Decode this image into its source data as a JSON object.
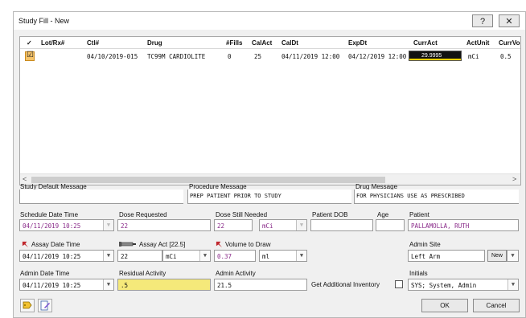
{
  "window": {
    "title": "Study Fill - New",
    "help": "?",
    "close": "✕"
  },
  "grid": {
    "columns": [
      "✓",
      "Lot/Rx#",
      "Ctl#",
      "Drug",
      "#Fills",
      "CalAct",
      "CalDt",
      "ExpDt",
      "CurrAct",
      "ActUnit",
      "CurrVol"
    ],
    "row": {
      "checked": "☑",
      "lot": "",
      "ctl": "04/10/2019-015",
      "drug": "TC99M CARDIOLITE",
      "fills": "0",
      "calact": "25",
      "caldt": "04/11/2019 12:00",
      "expdt": "04/12/2019 12:00",
      "curract": "29.9995",
      "actunit": "mCi",
      "currvol": "0.5"
    },
    "scroll_left": "<",
    "scroll_right": ">"
  },
  "messages": {
    "study_default_label": "Study Default Message",
    "study_default_value": "",
    "procedure_label": "Procedure Message",
    "procedure_value": "PREP PATIENT PRIOR TO STUDY",
    "drug_label": "Drug Message",
    "drug_value": "FOR PHYSICIANS USE AS PRESCRIBED"
  },
  "row1": {
    "schedule_label": "Schedule Date Time",
    "schedule_value": "04/11/2019 10:25",
    "dose_req_label": "Dose Requested",
    "dose_req_value": "22",
    "dose_still_label": "Dose Still Needed",
    "dose_still_value": "22",
    "dose_still_unit": "mCi",
    "dob_label": "Patient DOB",
    "dob_value": "",
    "age_label": "Age",
    "age_value": "",
    "patient_label": "Patient",
    "patient_value": "PALLAMOLLA, RUTH"
  },
  "row2": {
    "assay_dt_label": "Assay Date Time",
    "assay_dt_value": "04/11/2019 10:25",
    "assay_act_label": "Assay Act [22.5]",
    "assay_act_value": "22",
    "assay_act_unit": "mCi",
    "volume_label": "Volume to Draw",
    "volume_value": "0.37",
    "volume_unit": "ml",
    "site_label": "Admin Site",
    "site_value": "Left Arm",
    "site_new": "New"
  },
  "row3": {
    "admin_dt_label": "Admin Date Time",
    "admin_dt_value": "04/11/2019 10:25",
    "residual_label": "Residual Activity",
    "residual_value": ".5",
    "admin_act_label": "Admin Activity",
    "admin_act_value": "21.5",
    "inventory_label": "Get Additional Inventory",
    "initials_label": "Initials",
    "initials_value": "SYS; System, Admin"
  },
  "buttons": {
    "ok": "OK",
    "cancel": "Cancel"
  },
  "colors": {
    "accent_red": "#c0272d",
    "residual_bg": "#f5e97a",
    "curract_bg": "#111111",
    "checkbox_orange": "#f6c46a"
  }
}
